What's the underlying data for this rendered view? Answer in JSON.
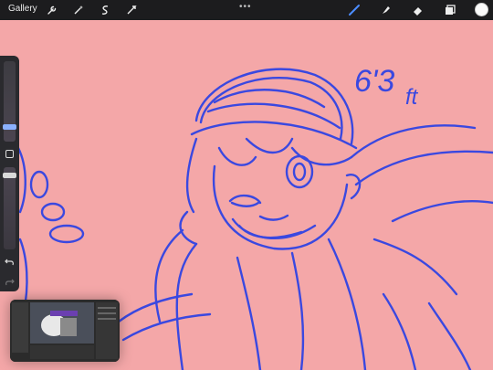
{
  "toolbar": {
    "gallery_label": "Gallery",
    "left_tools": [
      "wrench-icon",
      "magic-wand-icon",
      "selection-icon",
      "transform-icon"
    ],
    "right_tools": [
      "brush-icon",
      "smudge-icon",
      "eraser-icon",
      "layers-icon"
    ],
    "current_color": "#ffffff"
  },
  "canvas": {
    "background": "#f4a7a8",
    "ink_color": "#3a48e0",
    "note_line1": "6'3",
    "note_line2": "ft"
  }
}
